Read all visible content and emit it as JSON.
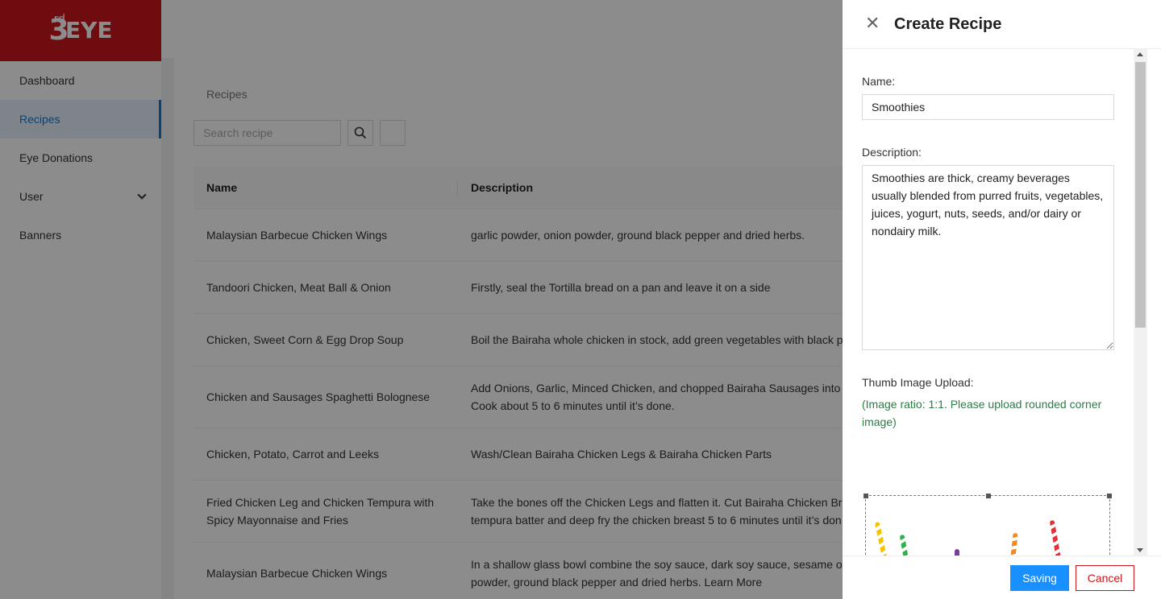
{
  "logo": {
    "num": "3",
    "sup": "rd",
    "word": "EYE"
  },
  "sidebar": {
    "items": [
      {
        "label": "Dashboard"
      },
      {
        "label": "Recipes"
      },
      {
        "label": "Eye Donations"
      },
      {
        "label": "User"
      },
      {
        "label": "Banners"
      }
    ]
  },
  "page": {
    "breadcrumb": "Recipes",
    "search_placeholder": "Search recipe"
  },
  "table": {
    "columns": [
      "Name",
      "Description"
    ],
    "rows": [
      {
        "name": "Malaysian Barbecue Chicken Wings",
        "description": "garlic powder, onion powder, ground black pepper and dried herbs."
      },
      {
        "name": "Tandoori Chicken, Meat Ball & Onion",
        "description": "Firstly, seal the Tortilla bread on a pan and leave it on a side"
      },
      {
        "name": "Chicken, Sweet Corn & Egg Drop Soup",
        "description": "Boil the Bairaha whole chicken in stock, add green vegetables with black pe"
      },
      {
        "name": "Chicken and Sausages Spaghetti Bolognese",
        "description": "Add Onions, Garlic, Minced Chicken, and chopped Bairaha Sausages into a",
        "description2": "Cook about 5 to 6 minutes until it’s done."
      },
      {
        "name": "Chicken, Potato, Carrot and Leeks",
        "description": "Wash/Clean Bairaha Chicken Legs & Bairaha Chicken Parts"
      },
      {
        "name": "Fried Chicken Leg and Chicken Tempura with Spicy Mayonnaise and Fries",
        "description": "Take the bones off the Chicken Legs and flatten it. Cut Bairaha Chicken Brea",
        "description2": "tempura batter and deep fry the chicken breast 5 to 6 minutes until it’s don"
      },
      {
        "name": "Malaysian Barbecue Chicken Wings",
        "description": "In a shallow glass bowl combine the soy sauce, dark soy sauce, sesame oil,",
        "description2": "powder, ground black pepper and dried herbs. Learn More"
      }
    ]
  },
  "drawer": {
    "title": "Create Recipe",
    "name_label": "Name:",
    "name_value": "Smoothies",
    "description_label": "Description:",
    "description_value": "Smoothies are thick, creamy beverages usually blended from purred fruits, vegetables, juices, yogurt, nuts, seeds, and/or dairy or nondairy milk.",
    "thumb_label": "Thumb Image Upload:",
    "thumb_hint": "(Image ratio: 1:1. Please upload rounded corner image)",
    "save_label": "Saving",
    "cancel_label": "Cancel"
  },
  "colors": {
    "brand": "#c8161d",
    "primary": "#1890ff",
    "active": "#1677d2",
    "hint": "#2f7a49"
  }
}
